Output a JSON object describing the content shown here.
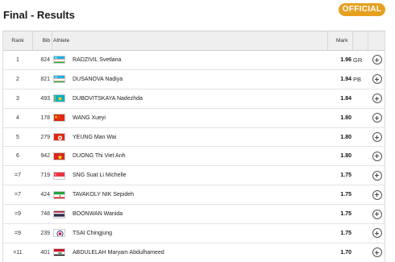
{
  "header": {
    "title": "Final - Results",
    "status_badge": "OFFICIAL"
  },
  "columns": {
    "rank": "Rank",
    "bib": "Bib",
    "athlete": "Athlete",
    "mark": "Mark"
  },
  "rows": [
    {
      "rank": "1",
      "bib": "824",
      "name": "RADZIVIL Svetlana",
      "mark": "1.96",
      "record": "GR",
      "flag": "uzb"
    },
    {
      "rank": "2",
      "bib": "821",
      "name": "DUSANOVA Nadiya",
      "mark": "1.94",
      "record": "PB",
      "flag": "uzb"
    },
    {
      "rank": "3",
      "bib": "493",
      "name": "DUBOVITSKAYA Nadezhda",
      "mark": "1.84",
      "record": "",
      "flag": "kaz"
    },
    {
      "rank": "4",
      "bib": "178",
      "name": "WANG Xueyi",
      "mark": "1.80",
      "record": "",
      "flag": "chn"
    },
    {
      "rank": "5",
      "bib": "279",
      "name": "YEUNG Man Wai",
      "mark": "1.80",
      "record": "",
      "flag": "hkg"
    },
    {
      "rank": "6",
      "bib": "942",
      "name": "DUONG Thi Viet Anh",
      "mark": "1.80",
      "record": "",
      "flag": "vie"
    },
    {
      "rank": "=7",
      "bib": "719",
      "name": "SNG Suat Li Michelle",
      "mark": "1.75",
      "record": "",
      "flag": "sgp"
    },
    {
      "rank": "=7",
      "bib": "424",
      "name": "TAVAKOLY NIK Sepideh",
      "mark": "1.75",
      "record": "",
      "flag": "iri"
    },
    {
      "rank": "=9",
      "bib": "748",
      "name": "BOONWAN Wanida",
      "mark": "1.75",
      "record": "",
      "flag": "tha"
    },
    {
      "rank": "=9",
      "bib": "239",
      "name": "TSAI Chingjung",
      "mark": "1.75",
      "record": "",
      "flag": "tpe"
    },
    {
      "rank": "=11",
      "bib": "401",
      "name": "ABDULELAH Maryam Abdulhameed",
      "mark": "1.70",
      "record": "",
      "flag": "irq"
    }
  ],
  "colors": {
    "badge": "#e6a020",
    "header_bg": "#efefef",
    "row_border": "#e3e3e3"
  },
  "icons": {
    "expand": "plus-circle-icon"
  }
}
